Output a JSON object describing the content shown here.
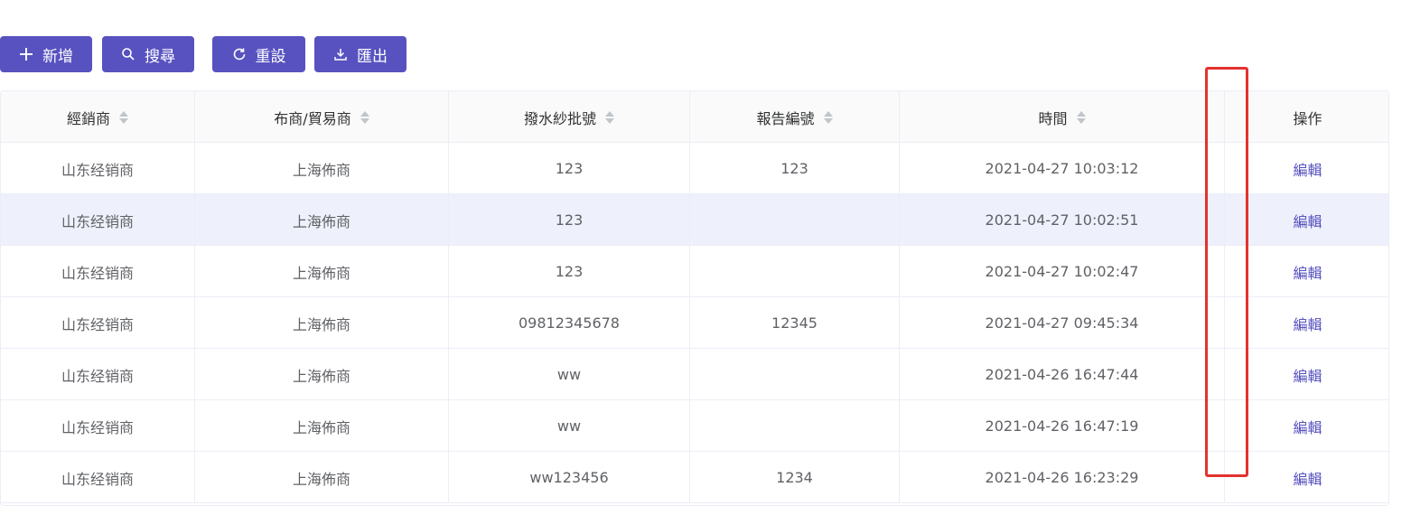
{
  "toolbar": {
    "add_label": "新增",
    "search_label": "搜尋",
    "reset_label": "重設",
    "export_label": "匯出"
  },
  "table": {
    "headers": [
      "經銷商",
      "布商/貿易商",
      "撥水紗批號",
      "報告編號",
      "時間",
      "操作"
    ],
    "rows": [
      {
        "dealer": "山东经销商",
        "trader": "上海佈商",
        "batch": "123",
        "report": "123",
        "time": "2021-04-27 10:03:12",
        "action": "編輯"
      },
      {
        "dealer": "山东经销商",
        "trader": "上海佈商",
        "batch": "123",
        "report": "",
        "time": "2021-04-27 10:02:51",
        "action": "編輯"
      },
      {
        "dealer": "山东经销商",
        "trader": "上海佈商",
        "batch": "123",
        "report": "",
        "time": "2021-04-27 10:02:47",
        "action": "編輯"
      },
      {
        "dealer": "山东经销商",
        "trader": "上海佈商",
        "batch": "09812345678",
        "report": "12345",
        "time": "2021-04-27 09:45:34",
        "action": "編輯"
      },
      {
        "dealer": "山东经销商",
        "trader": "上海佈商",
        "batch": "ww",
        "report": "",
        "time": "2021-04-26 16:47:44",
        "action": "編輯"
      },
      {
        "dealer": "山东经销商",
        "trader": "上海佈商",
        "batch": "ww",
        "report": "",
        "time": "2021-04-26 16:47:19",
        "action": "編輯"
      },
      {
        "dealer": "山东经销商",
        "trader": "上海佈商",
        "batch": "ww123456",
        "report": "1234",
        "time": "2021-04-26 16:23:29",
        "action": "編輯"
      }
    ]
  },
  "colors": {
    "accent": "#5752c0",
    "row_hover": "#eef0fb",
    "highlight_border": "#e3322d"
  },
  "icons": {
    "add": "plus-icon",
    "search": "search-icon",
    "reset": "refresh-icon",
    "export": "download-icon",
    "sort": "sort-caret-icon"
  }
}
